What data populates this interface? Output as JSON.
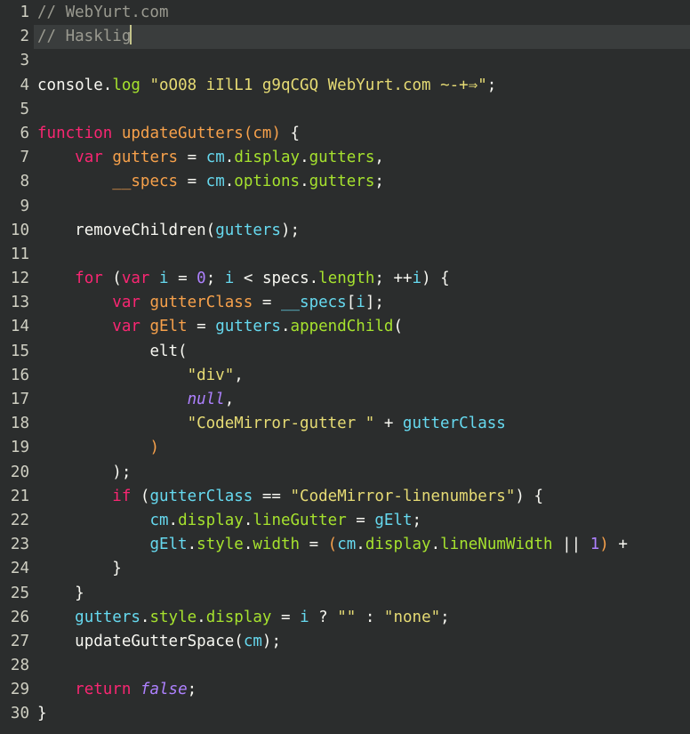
{
  "editor": {
    "name": "code-editor",
    "font_sample_name": "Hasklig",
    "background_color": "#2b2d2d",
    "active_line_color": "#3a3d3d",
    "gutter_text_color": "#cfcfc2",
    "cursor_color": "#c3c38a",
    "total_lines": 30,
    "active_line": 2,
    "cursor_line": 2,
    "cursor_column": 10,
    "palette": {
      "comment": "#9a9a90",
      "plain": "#f8f8f2",
      "keyword": "#f92672",
      "function": "#f7a14b",
      "variable": "#f7a14b",
      "identifier": "#66d9ef",
      "property": "#a6e22e",
      "string": "#e6db74",
      "constant": "#ae81ff",
      "number": "#ae81ff"
    }
  },
  "lines": [
    {
      "number": "1",
      "active": false,
      "tokens": [
        {
          "text": "// WebYurt.com",
          "cls": "t-comment"
        }
      ]
    },
    {
      "number": "2",
      "active": true,
      "cursor_after": true,
      "tokens": [
        {
          "text": "// Hasklig",
          "cls": "t-comment"
        }
      ]
    },
    {
      "number": "3",
      "active": false,
      "tokens": []
    },
    {
      "number": "4",
      "active": false,
      "tokens": [
        {
          "text": "console",
          "cls": "t-plain"
        },
        {
          "text": ".",
          "cls": "t-plain"
        },
        {
          "text": "log",
          "cls": "t-prop"
        },
        {
          "text": " ",
          "cls": "t-plain"
        },
        {
          "text": "\"oO08 iIlL1 g9qCGQ WebYurt.com ~-+⇒\"",
          "cls": "t-string"
        },
        {
          "text": ";",
          "cls": "t-plain"
        }
      ]
    },
    {
      "number": "5",
      "active": false,
      "tokens": []
    },
    {
      "number": "6",
      "active": false,
      "tokens": [
        {
          "text": "function",
          "cls": "t-keyword"
        },
        {
          "text": " ",
          "cls": "t-plain"
        },
        {
          "text": "updateGutters",
          "cls": "t-func"
        },
        {
          "text": "(",
          "cls": "t-paren-o"
        },
        {
          "text": "cm",
          "cls": "t-func"
        },
        {
          "text": ")",
          "cls": "t-paren-o"
        },
        {
          "text": " {",
          "cls": "t-plain"
        }
      ]
    },
    {
      "number": "7",
      "active": false,
      "tokens": [
        {
          "text": "    ",
          "cls": "t-plain"
        },
        {
          "text": "var",
          "cls": "t-keyword"
        },
        {
          "text": " ",
          "cls": "t-plain"
        },
        {
          "text": "gutters",
          "cls": "t-var"
        },
        {
          "text": " = ",
          "cls": "t-plain"
        },
        {
          "text": "cm",
          "cls": "t-ident"
        },
        {
          "text": ".",
          "cls": "t-plain"
        },
        {
          "text": "display",
          "cls": "t-prop"
        },
        {
          "text": ".",
          "cls": "t-plain"
        },
        {
          "text": "gutters",
          "cls": "t-prop"
        },
        {
          "text": ",",
          "cls": "t-plain"
        }
      ]
    },
    {
      "number": "8",
      "active": false,
      "tokens": [
        {
          "text": "        ",
          "cls": "t-plain"
        },
        {
          "text": "__specs",
          "cls": "t-var"
        },
        {
          "text": " = ",
          "cls": "t-plain"
        },
        {
          "text": "cm",
          "cls": "t-ident"
        },
        {
          "text": ".",
          "cls": "t-plain"
        },
        {
          "text": "options",
          "cls": "t-prop"
        },
        {
          "text": ".",
          "cls": "t-plain"
        },
        {
          "text": "gutters",
          "cls": "t-prop"
        },
        {
          "text": ";",
          "cls": "t-plain"
        }
      ]
    },
    {
      "number": "9",
      "active": false,
      "tokens": []
    },
    {
      "number": "10",
      "active": false,
      "tokens": [
        {
          "text": "    ",
          "cls": "t-plain"
        },
        {
          "text": "removeChildren",
          "cls": "t-plain"
        },
        {
          "text": "(",
          "cls": "t-plain"
        },
        {
          "text": "gutters",
          "cls": "t-ident"
        },
        {
          "text": ");",
          "cls": "t-plain"
        }
      ]
    },
    {
      "number": "11",
      "active": false,
      "tokens": []
    },
    {
      "number": "12",
      "active": false,
      "tokens": [
        {
          "text": "    ",
          "cls": "t-plain"
        },
        {
          "text": "for",
          "cls": "t-keyword"
        },
        {
          "text": " (",
          "cls": "t-plain"
        },
        {
          "text": "var",
          "cls": "t-keyword"
        },
        {
          "text": " ",
          "cls": "t-plain"
        },
        {
          "text": "i",
          "cls": "t-ident"
        },
        {
          "text": " = ",
          "cls": "t-plain"
        },
        {
          "text": "0",
          "cls": "t-number"
        },
        {
          "text": "; ",
          "cls": "t-plain"
        },
        {
          "text": "i",
          "cls": "t-ident"
        },
        {
          "text": " < ",
          "cls": "t-plain"
        },
        {
          "text": "specs",
          "cls": "t-plain"
        },
        {
          "text": ".",
          "cls": "t-plain"
        },
        {
          "text": "length",
          "cls": "t-prop"
        },
        {
          "text": "; ",
          "cls": "t-plain"
        },
        {
          "text": "++",
          "cls": "t-plain"
        },
        {
          "text": "i",
          "cls": "t-ident"
        },
        {
          "text": ") {",
          "cls": "t-plain"
        }
      ]
    },
    {
      "number": "13",
      "active": false,
      "tokens": [
        {
          "text": "        ",
          "cls": "t-plain"
        },
        {
          "text": "var",
          "cls": "t-keyword"
        },
        {
          "text": " ",
          "cls": "t-plain"
        },
        {
          "text": "gutterClass",
          "cls": "t-var"
        },
        {
          "text": " = ",
          "cls": "t-plain"
        },
        {
          "text": "__specs",
          "cls": "t-ident"
        },
        {
          "text": "[",
          "cls": "t-plain"
        },
        {
          "text": "i",
          "cls": "t-ident"
        },
        {
          "text": "];",
          "cls": "t-plain"
        }
      ]
    },
    {
      "number": "14",
      "active": false,
      "tokens": [
        {
          "text": "        ",
          "cls": "t-plain"
        },
        {
          "text": "var",
          "cls": "t-keyword"
        },
        {
          "text": " ",
          "cls": "t-plain"
        },
        {
          "text": "gElt",
          "cls": "t-var"
        },
        {
          "text": " = ",
          "cls": "t-plain"
        },
        {
          "text": "gutters",
          "cls": "t-ident"
        },
        {
          "text": ".",
          "cls": "t-plain"
        },
        {
          "text": "appendChild",
          "cls": "t-prop"
        },
        {
          "text": "(",
          "cls": "t-plain"
        }
      ]
    },
    {
      "number": "15",
      "active": false,
      "tokens": [
        {
          "text": "            ",
          "cls": "t-plain"
        },
        {
          "text": "elt",
          "cls": "t-plain"
        },
        {
          "text": "(",
          "cls": "t-plain"
        }
      ]
    },
    {
      "number": "16",
      "active": false,
      "tokens": [
        {
          "text": "                ",
          "cls": "t-plain"
        },
        {
          "text": "\"div\"",
          "cls": "t-string"
        },
        {
          "text": ",",
          "cls": "t-plain"
        }
      ]
    },
    {
      "number": "17",
      "active": false,
      "tokens": [
        {
          "text": "                ",
          "cls": "t-plain"
        },
        {
          "text": "null",
          "cls": "t-const"
        },
        {
          "text": ",",
          "cls": "t-plain"
        }
      ]
    },
    {
      "number": "18",
      "active": false,
      "tokens": [
        {
          "text": "                ",
          "cls": "t-plain"
        },
        {
          "text": "\"CodeMirror-gutter \"",
          "cls": "t-string"
        },
        {
          "text": " + ",
          "cls": "t-plain"
        },
        {
          "text": "gutterClass",
          "cls": "t-ident"
        }
      ]
    },
    {
      "number": "19",
      "active": false,
      "tokens": [
        {
          "text": "            ",
          "cls": "t-plain"
        },
        {
          "text": ")",
          "cls": "t-paren-o"
        }
      ]
    },
    {
      "number": "20",
      "active": false,
      "tokens": [
        {
          "text": "        ",
          "cls": "t-plain"
        },
        {
          "text": ");",
          "cls": "t-plain"
        }
      ]
    },
    {
      "number": "21",
      "active": false,
      "tokens": [
        {
          "text": "        ",
          "cls": "t-plain"
        },
        {
          "text": "if",
          "cls": "t-keyword"
        },
        {
          "text": " (",
          "cls": "t-plain"
        },
        {
          "text": "gutterClass",
          "cls": "t-ident"
        },
        {
          "text": " == ",
          "cls": "t-plain"
        },
        {
          "text": "\"CodeMirror-linenumbers\"",
          "cls": "t-string"
        },
        {
          "text": ") {",
          "cls": "t-plain"
        }
      ]
    },
    {
      "number": "22",
      "active": false,
      "tokens": [
        {
          "text": "            ",
          "cls": "t-plain"
        },
        {
          "text": "cm",
          "cls": "t-ident"
        },
        {
          "text": ".",
          "cls": "t-plain"
        },
        {
          "text": "display",
          "cls": "t-prop"
        },
        {
          "text": ".",
          "cls": "t-plain"
        },
        {
          "text": "lineGutter",
          "cls": "t-prop"
        },
        {
          "text": " = ",
          "cls": "t-plain"
        },
        {
          "text": "gElt",
          "cls": "t-ident"
        },
        {
          "text": ";",
          "cls": "t-plain"
        }
      ]
    },
    {
      "number": "23",
      "active": false,
      "tokens": [
        {
          "text": "            ",
          "cls": "t-plain"
        },
        {
          "text": "gElt",
          "cls": "t-ident"
        },
        {
          "text": ".",
          "cls": "t-plain"
        },
        {
          "text": "style",
          "cls": "t-prop"
        },
        {
          "text": ".",
          "cls": "t-plain"
        },
        {
          "text": "width",
          "cls": "t-prop"
        },
        {
          "text": " = ",
          "cls": "t-plain"
        },
        {
          "text": "(",
          "cls": "t-paren-o"
        },
        {
          "text": "cm",
          "cls": "t-ident"
        },
        {
          "text": ".",
          "cls": "t-plain"
        },
        {
          "text": "display",
          "cls": "t-prop"
        },
        {
          "text": ".",
          "cls": "t-plain"
        },
        {
          "text": "lineNumWidth",
          "cls": "t-prop"
        },
        {
          "text": " || ",
          "cls": "t-plain"
        },
        {
          "text": "1",
          "cls": "t-number"
        },
        {
          "text": ")",
          "cls": "t-paren-o"
        },
        {
          "text": " +",
          "cls": "t-plain"
        }
      ]
    },
    {
      "number": "24",
      "active": false,
      "tokens": [
        {
          "text": "        }",
          "cls": "t-plain"
        }
      ]
    },
    {
      "number": "25",
      "active": false,
      "tokens": [
        {
          "text": "    }",
          "cls": "t-plain"
        }
      ]
    },
    {
      "number": "26",
      "active": false,
      "tokens": [
        {
          "text": "    ",
          "cls": "t-plain"
        },
        {
          "text": "gutters",
          "cls": "t-ident"
        },
        {
          "text": ".",
          "cls": "t-plain"
        },
        {
          "text": "style",
          "cls": "t-prop"
        },
        {
          "text": ".",
          "cls": "t-plain"
        },
        {
          "text": "display",
          "cls": "t-prop"
        },
        {
          "text": " = ",
          "cls": "t-plain"
        },
        {
          "text": "i",
          "cls": "t-ident"
        },
        {
          "text": " ? ",
          "cls": "t-plain"
        },
        {
          "text": "\"\"",
          "cls": "t-string"
        },
        {
          "text": " : ",
          "cls": "t-plain"
        },
        {
          "text": "\"none\"",
          "cls": "t-string"
        },
        {
          "text": ";",
          "cls": "t-plain"
        }
      ]
    },
    {
      "number": "27",
      "active": false,
      "tokens": [
        {
          "text": "    ",
          "cls": "t-plain"
        },
        {
          "text": "updateGutterSpace",
          "cls": "t-plain"
        },
        {
          "text": "(",
          "cls": "t-plain"
        },
        {
          "text": "cm",
          "cls": "t-ident"
        },
        {
          "text": ");",
          "cls": "t-plain"
        }
      ]
    },
    {
      "number": "28",
      "active": false,
      "tokens": []
    },
    {
      "number": "29",
      "active": false,
      "tokens": [
        {
          "text": "    ",
          "cls": "t-plain"
        },
        {
          "text": "return",
          "cls": "t-keyword"
        },
        {
          "text": " ",
          "cls": "t-plain"
        },
        {
          "text": "false",
          "cls": "t-const"
        },
        {
          "text": ";",
          "cls": "t-plain"
        }
      ]
    },
    {
      "number": "30",
      "active": false,
      "tokens": [
        {
          "text": "}",
          "cls": "t-plain"
        }
      ]
    }
  ]
}
